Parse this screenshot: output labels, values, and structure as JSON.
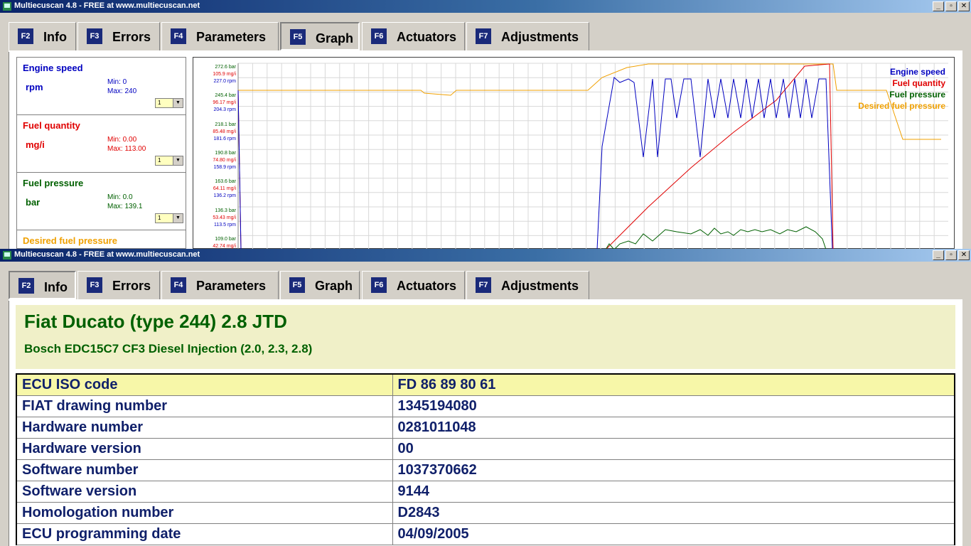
{
  "app": {
    "title": "Multiecuscan 4.8 - FREE at www.multiecuscan.net"
  },
  "window_buttons": {
    "minimize": "_",
    "restore": "▫",
    "close": "✕"
  },
  "tabs": [
    {
      "key": "F2",
      "label": "Info"
    },
    {
      "key": "F3",
      "label": "Errors"
    },
    {
      "key": "F4",
      "label": "Parameters"
    },
    {
      "key": "F5",
      "label": "Graph"
    },
    {
      "key": "F6",
      "label": "Actuators"
    },
    {
      "key": "F7",
      "label": "Adjustments"
    }
  ],
  "graph_window": {
    "active_tab": "Graph",
    "params": [
      {
        "name": "Engine speed",
        "unit": "rpm",
        "min": "Min: 0",
        "max": "Max: 240",
        "scale": "1",
        "color": "#0000c0"
      },
      {
        "name": "Fuel quantity",
        "unit": "mg/i",
        "min": "Min: 0.00",
        "max": "Max: 113.00",
        "scale": "1",
        "color": "#e00000"
      },
      {
        "name": "Fuel pressure",
        "unit": "bar",
        "min": "Min: 0.0",
        "max": "Max: 139.1",
        "scale": "1",
        "color": "#006000"
      },
      {
        "name": "Desired fuel pressure",
        "color": "#f0a000"
      }
    ],
    "y_ticks": [
      {
        "bar": "272.6 bar",
        "mg": "105.9 mg/i",
        "rpm": "227.0 rpm"
      },
      {
        "bar": "245.4 bar",
        "mg": "96.17 mg/i",
        "rpm": "204.3 rpm"
      },
      {
        "bar": "218.1 bar",
        "mg": "85.48 mg/i",
        "rpm": "181.6 rpm"
      },
      {
        "bar": "190.8 bar",
        "mg": "74.80 mg/i",
        "rpm": "158.9 rpm"
      },
      {
        "bar": "163.6 bar",
        "mg": "64.11 mg/i",
        "rpm": "136.2 rpm"
      },
      {
        "bar": "136.3 bar",
        "mg": "53.43 mg/i",
        "rpm": "113.5 rpm"
      },
      {
        "bar": "109.0 bar",
        "mg": "42.74 mg/i",
        "rpm": ""
      }
    ],
    "legend": [
      "Engine speed",
      "Fuel quantity",
      "Fuel pressure",
      "Desired fuel pressure"
    ]
  },
  "info_window": {
    "active_tab": "Info",
    "vehicle": "Fiat Ducato (type 244) 2.8 JTD",
    "ecu": "Bosch EDC15C7 CF3 Diesel Injection (2.0, 2.3, 2.8)",
    "rows": [
      {
        "label": "ECU ISO code",
        "value": "FD 86 89 80 61"
      },
      {
        "label": "FIAT drawing number",
        "value": "1345194080"
      },
      {
        "label": "Hardware number",
        "value": "0281011048"
      },
      {
        "label": "Hardware version",
        "value": "00"
      },
      {
        "label": "Software number",
        "value": "1037370662"
      },
      {
        "label": "Software version",
        "value": "9144"
      },
      {
        "label": "Homologation number",
        "value": "D2843"
      },
      {
        "label": "ECU programming date",
        "value": "04/09/2005"
      }
    ]
  }
}
